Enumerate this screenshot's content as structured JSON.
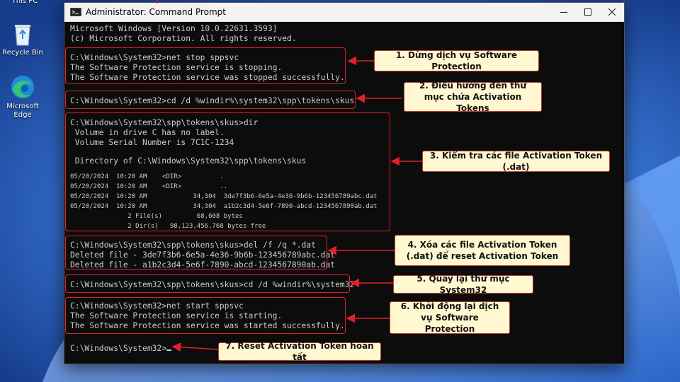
{
  "desktop": {
    "icons": [
      {
        "label": "This PC"
      },
      {
        "label": "Recycle Bin"
      },
      {
        "label": "Microsoft Edge"
      }
    ]
  },
  "window": {
    "title": "Administrator: Command Prompt",
    "controls": [
      "minimize",
      "maximize",
      "close"
    ]
  },
  "console": {
    "lines": [
      "Microsoft Windows [Version 10.0.22631.3593]",
      "(c) Microsoft Corporation. All rights reserved.",
      "C:\\Windows\\System32>net stop sppsvc",
      "The Software Protection service is stopping.",
      "The Software Protection service was stopped successfully.",
      "C:\\Windows\\System32>cd /d %windir%\\system32\\spp\\tokens\\skus",
      "C:\\Windows\\System32\\spp\\tokens\\skus>dir",
      " Volume in drive C has no label.",
      " Volume Serial Number is 7C1C-1234",
      " Directory of C:\\Windows\\System32\\spp\\tokens\\skus",
      "05/20/2024  10:20 AM    <DIR>          .",
      "05/20/2024  10:20 AM    <DIR>          ..",
      "05/20/2024  10:20 AM            34,304  3de7f3b6-6e5a-4e36-9b6b-123456789abc.dat",
      "05/20/2024  10:20 AM            34,304  a1b2c3d4-5e6f-7890-abcd-1234567890ab.dat",
      "               2 File(s)         68,608 bytes",
      "               2 Dir(s)   98,123,456,768 bytes free",
      "C:\\Windows\\System32\\spp\\tokens\\skus>del /f /q *.dat",
      "Deleted file - 3de7f3b6-6e5a-4e36-9b6b-123456789abc.dat",
      "Deleted file - a1b2c3d4-5e6f-7890-abcd-1234567890ab.dat",
      "C:\\Windows\\System32\\spp\\tokens\\skus>cd /d %windir%\\system32",
      "C:\\Windows\\System32>net start sppsvc",
      "The Software Protection service is starting.",
      "The Software Protection service was started successfully.",
      "C:\\Windows\\System32>"
    ]
  },
  "callouts": [
    "1. Dừng dịch vụ Software Protection",
    "2. Điều hướng đến thư mục chứa Activation Tokens",
    "3. Kiểm tra các file Activation Token (.dat)",
    "4. Xóa các file Activation Token (.dat) để reset Activation Token",
    "5. Quay lại thư mục System32",
    "6. Khởi động lại dịch vụ Software Protection",
    "7. Reset Activation Token hoàn tất"
  ],
  "colors": {
    "accent_red": "#e0202a",
    "callout_bg": "#fff8d0",
    "console_bg": "#0c0c0c",
    "console_text": "#cccccc"
  }
}
